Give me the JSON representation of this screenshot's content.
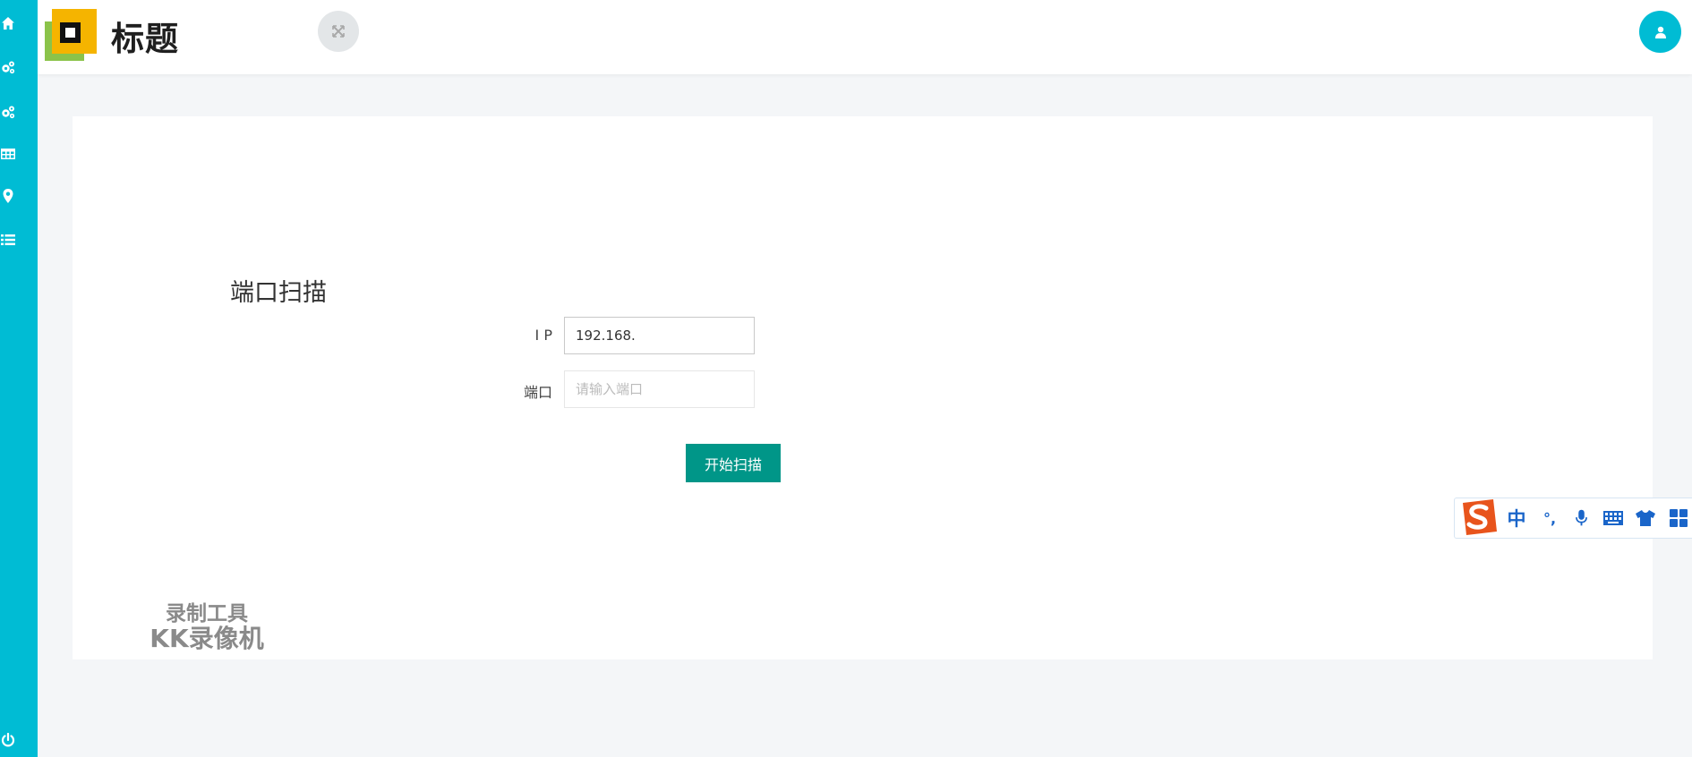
{
  "app": {
    "title": "标题"
  },
  "sidebar": {
    "items": [
      {
        "icon": "home-icon",
        "name": "home"
      },
      {
        "icon": "gears-icon",
        "name": "settings-1"
      },
      {
        "icon": "gears-icon",
        "name": "settings-2"
      },
      {
        "icon": "table-icon",
        "name": "table"
      },
      {
        "icon": "map-marker-icon",
        "name": "location"
      },
      {
        "icon": "list-icon",
        "name": "list"
      }
    ],
    "footer_icon": "power-icon"
  },
  "header": {
    "fullscreen_icon": "expand-icon",
    "user_icon": "user-icon"
  },
  "main": {
    "section_title": "端口扫描",
    "form": {
      "ip_label": "I P",
      "ip_value": "192.168.",
      "port_label": "端口",
      "port_placeholder": "请输入端口",
      "port_value": "",
      "submit_label": "开始扫描"
    }
  },
  "watermark": {
    "line1": "录制工具",
    "line2": "KK录像机"
  },
  "ime_toolbar": {
    "mode": "中",
    "punctuation": "°,",
    "icons": [
      "sogou-logo-icon",
      "microphone-icon",
      "keyboard-icon",
      "skin-shirt-icon",
      "toolbox-icon"
    ]
  },
  "colors": {
    "sidebar": "#00bcd4",
    "primary_button": "#009688",
    "page_background": "#f4f6f8",
    "card_background": "#ffffff",
    "logo_yellow": "#f5b400",
    "logo_green": "#8bc34a"
  }
}
